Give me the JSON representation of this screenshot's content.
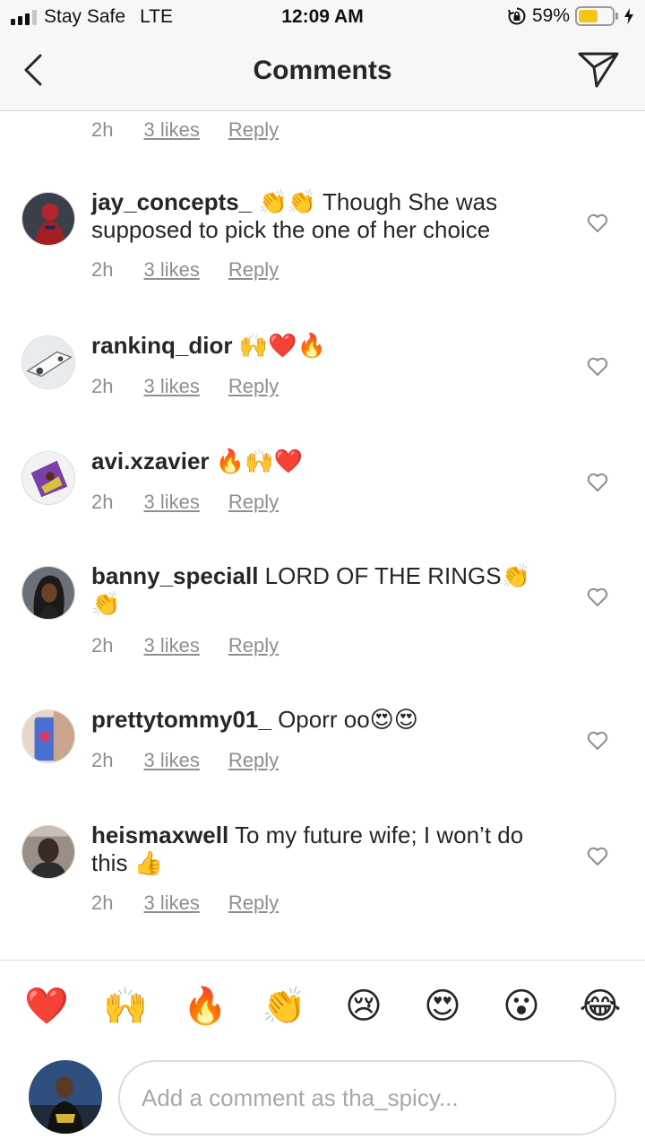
{
  "status_bar": {
    "carrier": "Stay Safe",
    "network": "LTE",
    "time": "12:09 AM",
    "battery_percent": "59%",
    "battery_level": 0.59
  },
  "nav": {
    "title": "Comments"
  },
  "comments": [
    {
      "username": "",
      "text": "",
      "time": "2h",
      "likes": "3 likes",
      "reply": "Reply"
    },
    {
      "username": "jay_concepts_",
      "text": " 👏👏 Though She was supposed to pick the one of her choice",
      "time": "2h",
      "likes": "3 likes",
      "reply": "Reply"
    },
    {
      "username": "rankinq_dior",
      "text": " 🙌❤️🔥",
      "time": "2h",
      "likes": "3 likes",
      "reply": "Reply"
    },
    {
      "username": "avi.xzavier",
      "text": " 🔥🙌❤️",
      "time": "2h",
      "likes": "3 likes",
      "reply": "Reply"
    },
    {
      "username": "banny_speciall",
      "text": " LORD OF THE RINGS👏👏",
      "time": "2h",
      "likes": "3 likes",
      "reply": "Reply"
    },
    {
      "username": "prettytommy01_",
      "text": " Oporr oo😍😍",
      "time": "2h",
      "likes": "3 likes",
      "reply": "Reply"
    },
    {
      "username": "heismaxwell",
      "text": " To my future wife; I won’t do this 👍",
      "time": "2h",
      "likes": "3 likes",
      "reply": "Reply"
    }
  ],
  "emoji_bar": [
    "❤️",
    "🙌",
    "🔥",
    "👏",
    "😢",
    "😍",
    "😮",
    "😂"
  ],
  "composer": {
    "placeholder": "Add a comment as tha_spicy..."
  },
  "colors": {
    "text": "#262626",
    "meta": "#8e8e8e",
    "divider": "#dbdbdb",
    "battery": "#f5c518"
  }
}
